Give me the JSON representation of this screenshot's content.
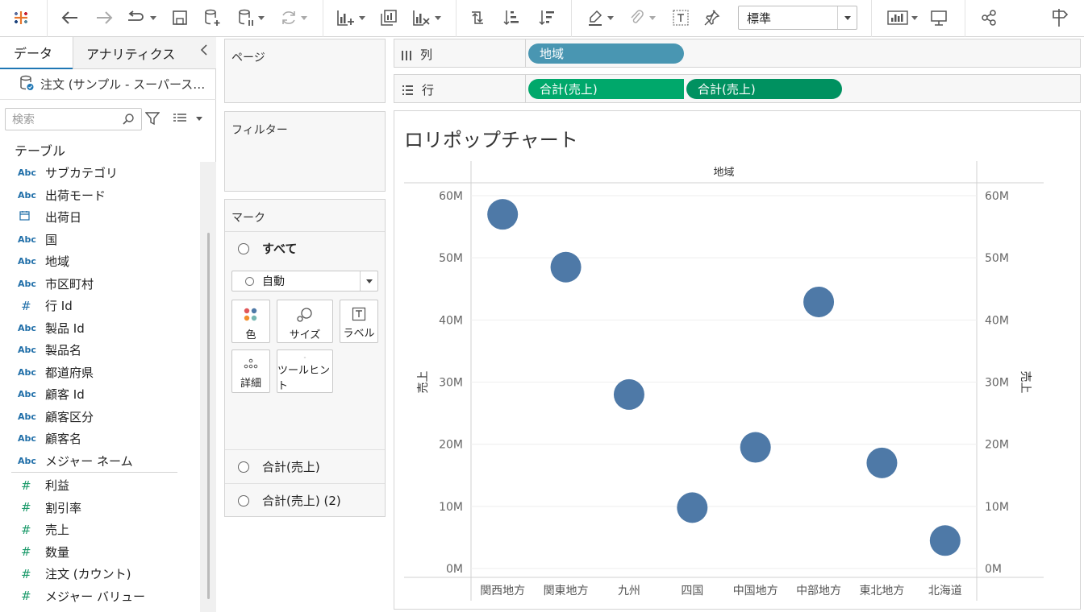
{
  "toolbar": {
    "fit_value": "標準",
    "icons": [
      "tableau-logo-icon",
      "undo-icon",
      "redo-icon",
      "replay-icon",
      "save-icon",
      "new-datasource-icon",
      "pause-update-icon",
      "refresh-icon",
      "new-sheet-icon",
      "duplicate-sheet-icon",
      "clear-sheet-icon",
      "swap-icon",
      "sort-asc-icon",
      "sort-desc-icon",
      "highlight-icon",
      "group-icon",
      "label-icon",
      "pin-icon",
      "show-me-icon",
      "presentation-icon",
      "share-icon",
      "sign-in-icon"
    ]
  },
  "data_pane": {
    "tab_data": "データ",
    "tab_analytics": "アナリティクス",
    "datasource": "注文 (サンプル - スーパース…",
    "search_placeholder": "検索",
    "table_heading": "テーブル",
    "dimensions": [
      {
        "type": "Abc",
        "name": "サブカテゴリ"
      },
      {
        "type": "Abc",
        "name": "出荷モード"
      },
      {
        "type": "date",
        "name": "出荷日"
      },
      {
        "type": "Abc",
        "name": "国"
      },
      {
        "type": "Abc",
        "name": "地域"
      },
      {
        "type": "Abc",
        "name": "市区町村"
      },
      {
        "type": "#",
        "name": "行 Id"
      },
      {
        "type": "Abc",
        "name": "製品 Id"
      },
      {
        "type": "Abc",
        "name": "製品名"
      },
      {
        "type": "Abc",
        "name": "都道府県"
      },
      {
        "type": "Abc",
        "name": "顧客 Id"
      },
      {
        "type": "Abc",
        "name": "顧客区分"
      },
      {
        "type": "Abc",
        "name": "顧客名"
      },
      {
        "type": "Abc",
        "name": "メジャー ネーム"
      }
    ],
    "measures": [
      {
        "type": "#",
        "name": "利益"
      },
      {
        "type": "#",
        "name": "割引率"
      },
      {
        "type": "#",
        "name": "売上"
      },
      {
        "type": "#",
        "name": "数量"
      },
      {
        "type": "#",
        "name": "注文 (カウント)"
      },
      {
        "type": "#",
        "name": "メジャー バリュー"
      }
    ]
  },
  "cards": {
    "pages": "ページ",
    "filters": "フィルター",
    "marks": "マーク",
    "marks_all": "すべて",
    "mark_type": "自動",
    "btn_color": "色",
    "btn_size": "サイズ",
    "btn_label": "ラベル",
    "btn_detail": "詳細",
    "btn_tooltip": "ツールヒント",
    "marks_layer1": "合計(売上)",
    "marks_layer2": "合計(売上) (2)"
  },
  "shelves": {
    "columns_label": "列",
    "rows_label": "行",
    "columns_pill": "地域",
    "rows_pill1": "合計(売上)",
    "rows_pill2": "合計(売上)"
  },
  "view": {
    "title": "ロリポップチャート"
  },
  "chart_data": {
    "type": "scatter",
    "header": "地域",
    "ylabel": "売上",
    "ylim": [
      0,
      60000000
    ],
    "y_ticks": [
      "0M",
      "10M",
      "20M",
      "30M",
      "40M",
      "50M",
      "60M"
    ],
    "categories": [
      "関西地方",
      "関東地方",
      "九州",
      "四国",
      "中国地方",
      "中部地方",
      "東北地方",
      "北海道"
    ],
    "values": [
      57000000,
      48500000,
      28000000,
      9800000,
      19500000,
      42900000,
      17000000,
      4500000
    ],
    "mark_color": "#4e79a7"
  }
}
